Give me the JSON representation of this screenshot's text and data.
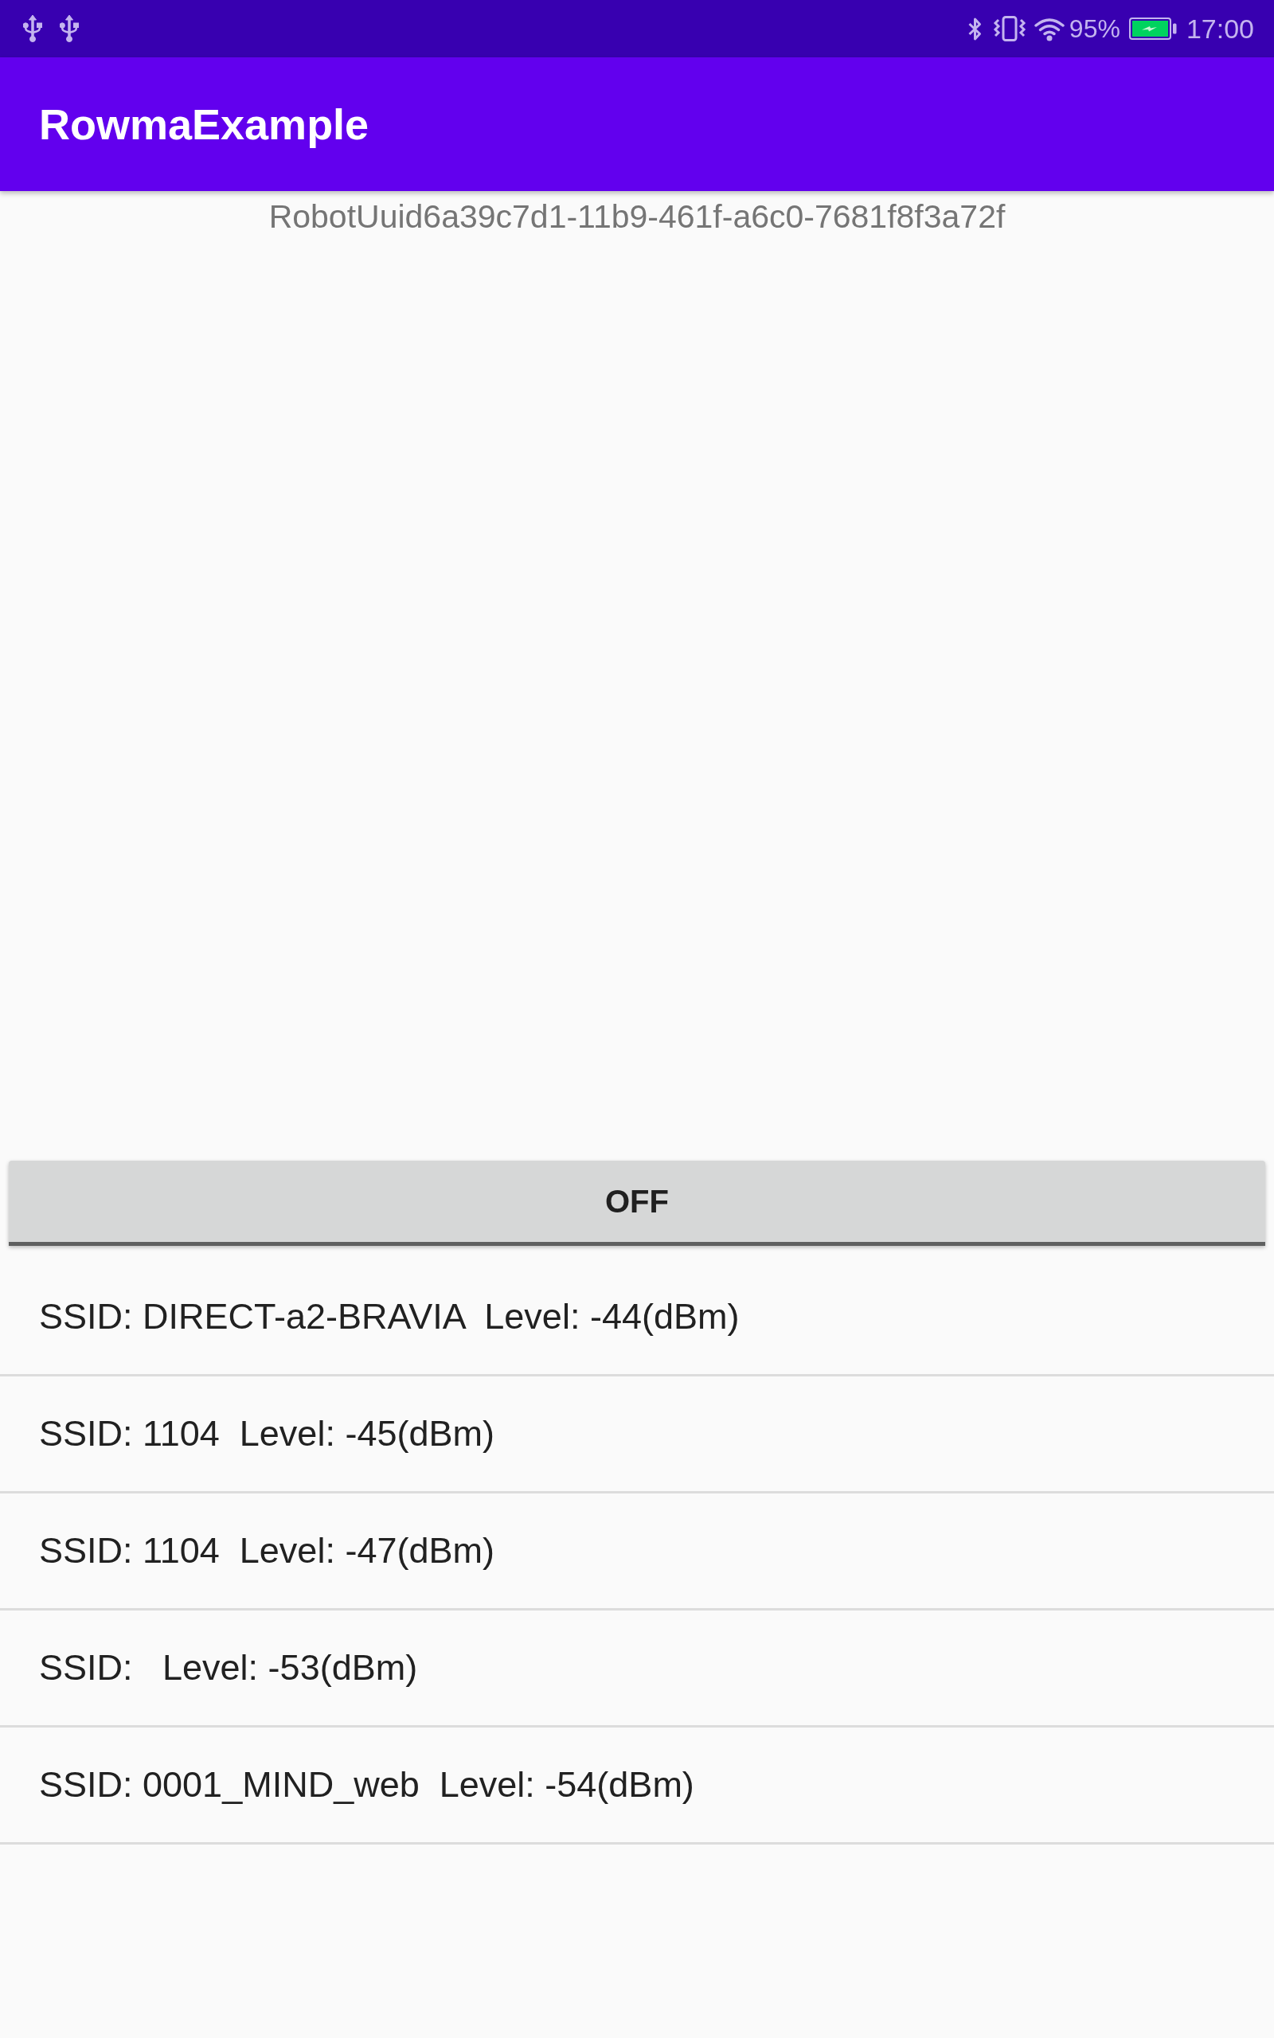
{
  "status_bar": {
    "battery": "95%",
    "time": "17:00"
  },
  "app_bar": {
    "title": "RowmaExample"
  },
  "robot_uuid": "RobotUuid6a39c7d1-11b9-461f-a6c0-7681f8f3a72f",
  "toggle_button": {
    "label": "OFF"
  },
  "wifi_list": [
    "SSID: DIRECT-a2-BRAVIA  Level: -44(dBm)",
    "SSID: 1104  Level: -45(dBm)",
    "SSID: 1104  Level: -47(dBm)",
    "SSID:   Level: -53(dBm)",
    "SSID: 0001_MIND_web  Level: -54(dBm)"
  ]
}
